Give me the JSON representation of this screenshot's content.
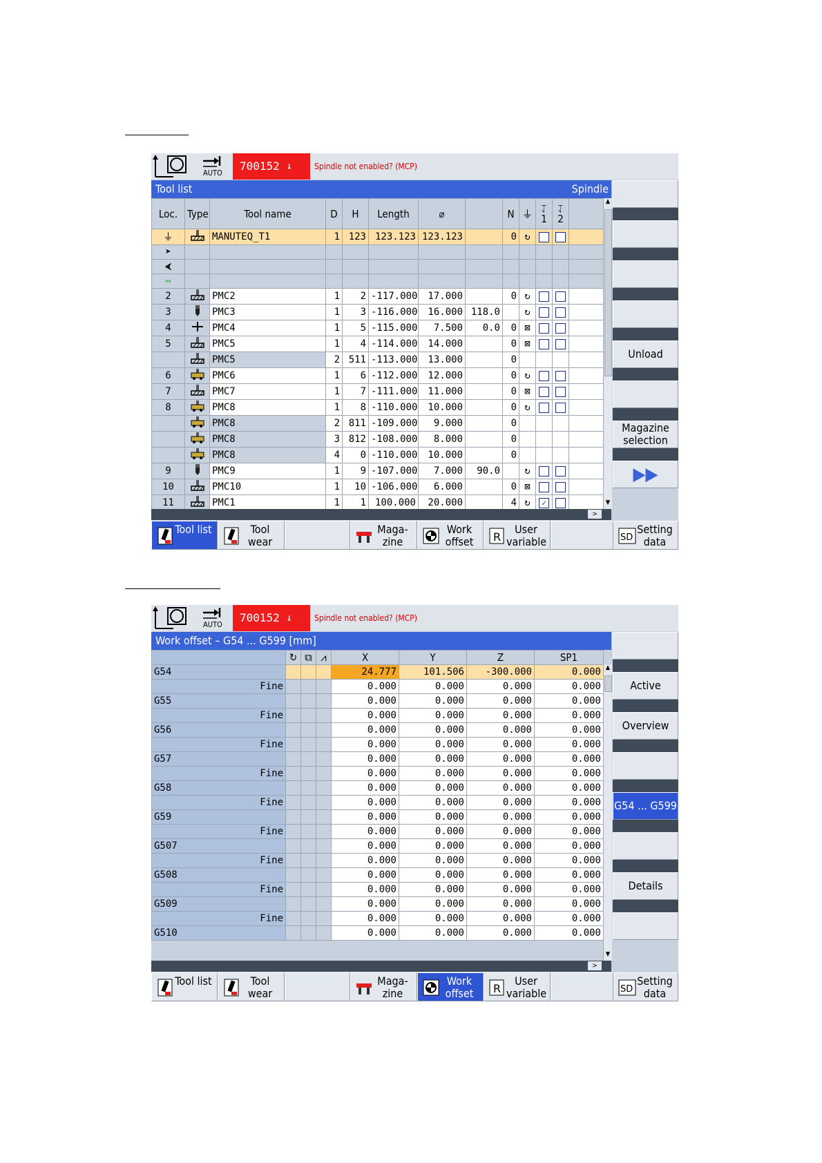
{
  "alarm": {
    "number": "700152",
    "message": "Spindle not enabled? (MCP)"
  },
  "mode_label": "AUTO",
  "tool_list": {
    "title": "Tool list",
    "title_right": "Spindle",
    "columns": [
      "Loc.",
      "Type",
      "Tool name",
      "D",
      "H",
      "Length",
      "⌀",
      "",
      "N",
      "1",
      "2"
    ],
    "rows": [
      {
        "loc": "",
        "name": "MANUTEQ_T1",
        "d": "1",
        "h": "123",
        "len": "123.123",
        "dia": "123.123",
        "x": "",
        "n": "0",
        "sp": "↻",
        "c1": "",
        "c2": "",
        "hasbox": true,
        "sel": true,
        "icon": "mill"
      },
      {
        "loc": "",
        "name": "",
        "d": "",
        "h": "",
        "len": "",
        "dia": "",
        "x": "",
        "n": "",
        "sp": "",
        "c1": "",
        "c2": "",
        "hasbox": false,
        "icon": ""
      },
      {
        "loc": "",
        "name": "",
        "d": "",
        "h": "",
        "len": "",
        "dia": "",
        "x": "",
        "n": "",
        "sp": "",
        "c1": "",
        "c2": "",
        "hasbox": false,
        "icon": ""
      },
      {
        "loc": "",
        "name": "",
        "d": "",
        "h": "",
        "len": "",
        "dia": "",
        "x": "",
        "n": "",
        "sp": "",
        "c1": "",
        "c2": "",
        "hasbox": false,
        "icon": ""
      },
      {
        "loc": "2",
        "name": "PMC2",
        "d": "1",
        "h": "2",
        "len": "-117.000",
        "dia": "17.000",
        "x": "",
        "n": "0",
        "sp": "↻",
        "hasbox": true,
        "icon": "mill"
      },
      {
        "loc": "3",
        "name": "PMC3",
        "d": "1",
        "h": "3",
        "len": "-116.000",
        "dia": "16.000",
        "x": "118.0",
        "n": "",
        "sp": "↻",
        "hasbox": true,
        "icon": "drill"
      },
      {
        "loc": "4",
        "name": "PMC4",
        "d": "1",
        "h": "5",
        "len": "-115.000",
        "dia": "7.500",
        "x": "0.0",
        "n": "0",
        "sp": "⊠",
        "hasbox": true,
        "icon": "cross"
      },
      {
        "loc": "5",
        "name": "PMC5",
        "d": "1",
        "h": "4",
        "len": "-114.000",
        "dia": "14.000",
        "x": "",
        "n": "0",
        "sp": "⊠",
        "hasbox": true,
        "icon": "mill"
      },
      {
        "loc": "",
        "name": "PMC5",
        "d": "2",
        "h": "511",
        "len": "-113.000",
        "dia": "13.000",
        "x": "",
        "n": "0",
        "sp": "",
        "hasbox": false,
        "icon": "mill"
      },
      {
        "loc": "6",
        "name": "PMC6",
        "d": "1",
        "h": "6",
        "len": "-112.000",
        "dia": "12.000",
        "x": "",
        "n": "0",
        "sp": "↻",
        "hasbox": true,
        "icon": "face"
      },
      {
        "loc": "7",
        "name": "PMC7",
        "d": "1",
        "h": "7",
        "len": "-111.000",
        "dia": "11.000",
        "x": "",
        "n": "0",
        "sp": "⊠",
        "hasbox": true,
        "icon": "mill"
      },
      {
        "loc": "8",
        "name": "PMC8",
        "d": "1",
        "h": "8",
        "len": "-110.000",
        "dia": "10.000",
        "x": "",
        "n": "0",
        "sp": "↻",
        "hasbox": true,
        "icon": "face"
      },
      {
        "loc": "",
        "name": "PMC8",
        "d": "2",
        "h": "811",
        "len": "-109.000",
        "dia": "9.000",
        "x": "",
        "n": "0",
        "sp": "",
        "hasbox": false,
        "icon": "face"
      },
      {
        "loc": "",
        "name": "PMC8",
        "d": "3",
        "h": "812",
        "len": "-108.000",
        "dia": "8.000",
        "x": "",
        "n": "0",
        "sp": "",
        "hasbox": false,
        "icon": "face"
      },
      {
        "loc": "",
        "name": "PMC8",
        "d": "4",
        "h": "0",
        "len": "-110.000",
        "dia": "10.000",
        "x": "",
        "n": "0",
        "sp": "",
        "hasbox": false,
        "icon": "face"
      },
      {
        "loc": "9",
        "name": "PMC9",
        "d": "1",
        "h": "9",
        "len": "-107.000",
        "dia": "7.000",
        "x": "90.0",
        "n": "",
        "sp": "↻",
        "hasbox": true,
        "icon": "drill"
      },
      {
        "loc": "10",
        "name": "PMC10",
        "d": "1",
        "h": "10",
        "len": "-106.000",
        "dia": "6.000",
        "x": "",
        "n": "0",
        "sp": "⊠",
        "hasbox": true,
        "icon": "mill"
      },
      {
        "loc": "11",
        "name": "PMC1",
        "d": "1",
        "h": "1",
        "len": "100.000",
        "dia": "20.000",
        "x": "",
        "n": "4",
        "sp": "↻",
        "hasbox": true,
        "checked": true,
        "icon": "mill"
      }
    ],
    "vertical_softkeys": [
      "",
      "",
      "",
      "",
      "Unload",
      "",
      "Magazine selection",
      "▶▶"
    ],
    "horizontal_softkeys": [
      {
        "label": "Tool list",
        "active": true
      },
      {
        "label": "Tool wear",
        "active": false
      },
      {
        "label": "",
        "active": false
      },
      {
        "label": "Maga- zine",
        "active": false
      },
      {
        "label": "Work offset",
        "active": false
      },
      {
        "label": "User variable",
        "active": false
      },
      {
        "label": "",
        "active": false
      },
      {
        "label": "Setting data",
        "active": false
      }
    ]
  },
  "work_offset": {
    "title": "Work offset –   G54 ... G599  [mm]",
    "columns": [
      "X",
      "Y",
      "Z",
      "SP1"
    ],
    "fine_label": "Fine",
    "rows": [
      {
        "name": "G54",
        "x": "24.777",
        "y": "101.506",
        "z": "-300.000",
        "sp1": "0.000"
      },
      {
        "name": "G55",
        "x": "0.000",
        "y": "0.000",
        "z": "0.000",
        "sp1": "0.000"
      },
      {
        "name": "G56",
        "x": "0.000",
        "y": "0.000",
        "z": "0.000",
        "sp1": "0.000"
      },
      {
        "name": "G57",
        "x": "0.000",
        "y": "0.000",
        "z": "0.000",
        "sp1": "0.000"
      },
      {
        "name": "G58",
        "x": "0.000",
        "y": "0.000",
        "z": "0.000",
        "sp1": "0.000"
      },
      {
        "name": "G59",
        "x": "0.000",
        "y": "0.000",
        "z": "0.000",
        "sp1": "0.000"
      },
      {
        "name": "G507",
        "x": "0.000",
        "y": "0.000",
        "z": "0.000",
        "sp1": "0.000"
      },
      {
        "name": "G508",
        "x": "0.000",
        "y": "0.000",
        "z": "0.000",
        "sp1": "0.000"
      },
      {
        "name": "G509",
        "x": "0.000",
        "y": "0.000",
        "z": "0.000",
        "sp1": "0.000"
      }
    ],
    "fine_values": {
      "x": "0.000",
      "y": "0.000",
      "z": "0.000",
      "sp1": "0.000"
    },
    "last_row": {
      "name": "G510",
      "x": "0.000",
      "y": "0.000",
      "z": "0.000",
      "sp1": "0.000"
    },
    "vertical_softkeys": [
      "",
      "Active",
      "Overview",
      "",
      "G54 ... G599",
      "",
      "Details",
      ""
    ],
    "horizontal_softkeys": [
      {
        "label": "Tool list",
        "active": false
      },
      {
        "label": "Tool wear",
        "active": false
      },
      {
        "label": "",
        "active": false
      },
      {
        "label": "Maga- zine",
        "active": false
      },
      {
        "label": "Work offset",
        "active": true
      },
      {
        "label": "User variable",
        "active": false
      },
      {
        "label": "",
        "active": false
      },
      {
        "label": "Setting data",
        "active": false
      }
    ]
  }
}
